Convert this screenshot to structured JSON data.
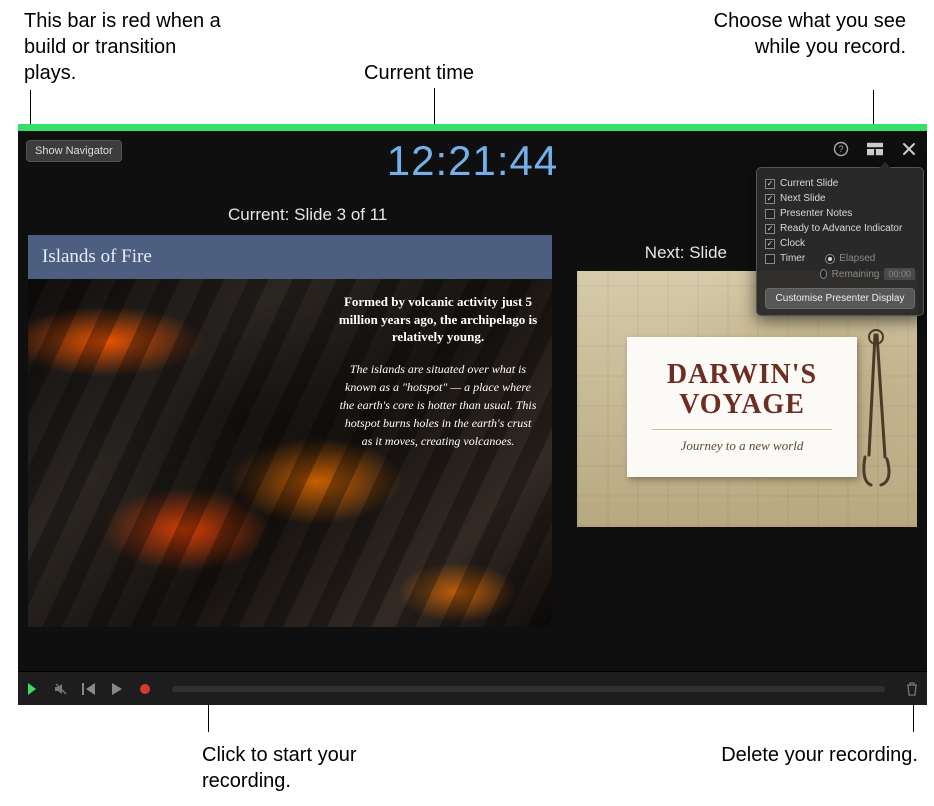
{
  "callouts": {
    "top_left": "This bar is red when a build or transition plays.",
    "top_mid": "Current time",
    "top_right": "Choose what you see while you record.",
    "bottom_left": "Click to start your recording.",
    "bottom_right": "Delete your recording."
  },
  "toolbar": {
    "show_navigator_label": "Show Navigator"
  },
  "clock": "12:21:44",
  "labels": {
    "current": "Current: Slide 3 of 11",
    "next": "Next: Slide"
  },
  "current_slide": {
    "title": "Islands of Fire",
    "blurb_bold": "Formed by volcanic activity just 5 million years ago, the archipelago is relatively young.",
    "blurb_italic": "The islands are situated over what is known as a \"hotspot\" — a place where the earth's core is hotter than usual. This hotspot burns holes in the earth's crust as it moves, creating volcanoes."
  },
  "next_slide": {
    "title_line1": "DARWIN'S",
    "title_line2": "VOYAGE",
    "subtitle": "Journey to a new world"
  },
  "popover": {
    "options": [
      {
        "label": "Current Slide",
        "checked": true
      },
      {
        "label": "Next Slide",
        "checked": true
      },
      {
        "label": "Presenter Notes",
        "checked": false
      },
      {
        "label": "Ready to Advance Indicator",
        "checked": true
      },
      {
        "label": "Clock",
        "checked": true
      },
      {
        "label": "Timer",
        "checked": false
      }
    ],
    "timer_modes": {
      "elapsed": {
        "label": "Elapsed",
        "selected": true
      },
      "remaining": {
        "label": "Remaining",
        "selected": false
      }
    },
    "timer_value": "00:00",
    "customise_label": "Customise Presenter Display"
  }
}
